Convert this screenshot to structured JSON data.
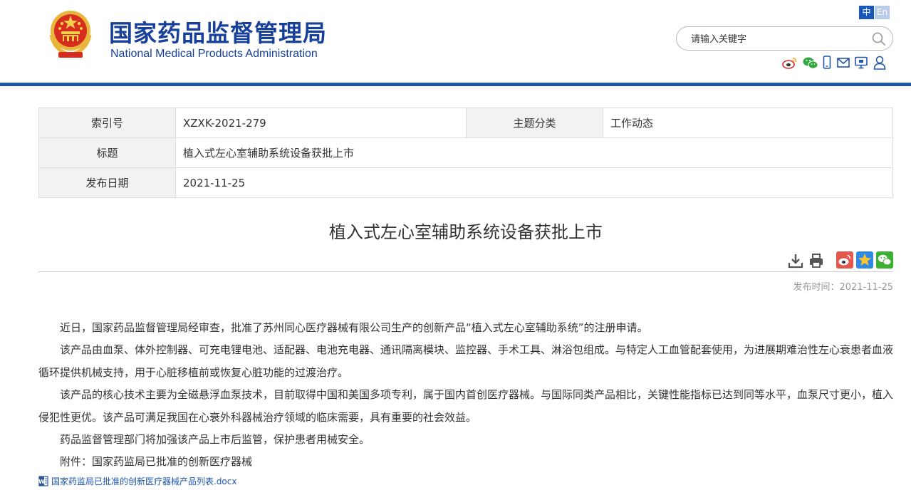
{
  "header": {
    "title_cn": "国家药品监督管理局",
    "title_en": "National Medical Products Administration",
    "lang_zh": "中",
    "lang_en": "En",
    "search_placeholder": "请输入关键字",
    "icons": [
      "weibo-icon",
      "wechat-icon",
      "mobile-icon",
      "mail-icon",
      "computer-icon",
      "user-icon"
    ]
  },
  "meta": {
    "index_label": "索引号",
    "index_value": "XZXK-2021-279",
    "topic_label": "主题分类",
    "topic_value": "工作动态",
    "title_label": "标题",
    "title_value": "植入式左心室辅助系统设备获批上市",
    "date_label": "发布日期",
    "date_value": "2021-11-25"
  },
  "article": {
    "title": "植入式左心室辅助系统设备获批上市",
    "pubdate": "发布时间：2021-11-25",
    "paragraphs": [
      "近日，国家药品监督管理局经审查，批准了苏州同心医疗器械有限公司生产的创新产品“植入式左心室辅助系统”的注册申请。",
      "该产品由血泵、体外控制器、可充电锂电池、适配器、电池充电器、通讯隔离模块、监控器、手术工具、淋浴包组成。与特定人工血管配套使用，为进展期难治性左心衰患者血液循环提供机械支持，用于心脏移植前或恢复心脏功能的过渡治疗。",
      "该产品的核心技术主要为全磁悬浮血泵技术，目前取得中国和美国多项专利，属于国内首创医疗器械。与国际同类产品相比，关键性能指标已达到同等水平，血泵尺寸更小，植入侵犯性更优。该产品可满足我国在心衰外科器械治疗领域的临床需要，具有重要的社会效益。",
      "药品监督管理部门将加强该产品上市后监管，保护患者用械安全。",
      "附件：国家药监局已批准的创新医疗器械"
    ],
    "attachment": "国家药监局已批准的创新医疗器械产品列表.docx"
  },
  "colors": {
    "brand_blue": "#17409a",
    "bar_blue": "#2155a8",
    "link_blue": "#1a56b0"
  }
}
